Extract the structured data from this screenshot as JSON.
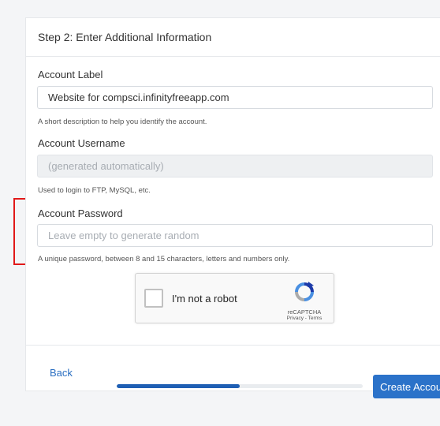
{
  "step_title": "Step 2: Enter Additional Information",
  "fields": {
    "label": {
      "label": "Account Label",
      "value": "Website for compsci.infinityfreeapp.com",
      "help": "A short description to help you identify the account."
    },
    "username": {
      "label": "Account Username",
      "placeholder": "(generated automatically)",
      "help": "Used to login to FTP, MySQL, etc."
    },
    "password": {
      "label": "Account Password",
      "placeholder": "Leave empty to generate random",
      "help": "A unique password, between 8 and 15 characters, letters and numbers only."
    }
  },
  "captcha": {
    "label": "I'm not a robot",
    "brand": "reCAPTCHA",
    "links": "Privacy - Terms"
  },
  "footer": {
    "back_label": "Back",
    "progress_percent": 50,
    "create_label": "Create Account"
  },
  "colors": {
    "primary": "#2b72c9",
    "progress": "#1f5fb4",
    "highlight": "#e11919"
  }
}
